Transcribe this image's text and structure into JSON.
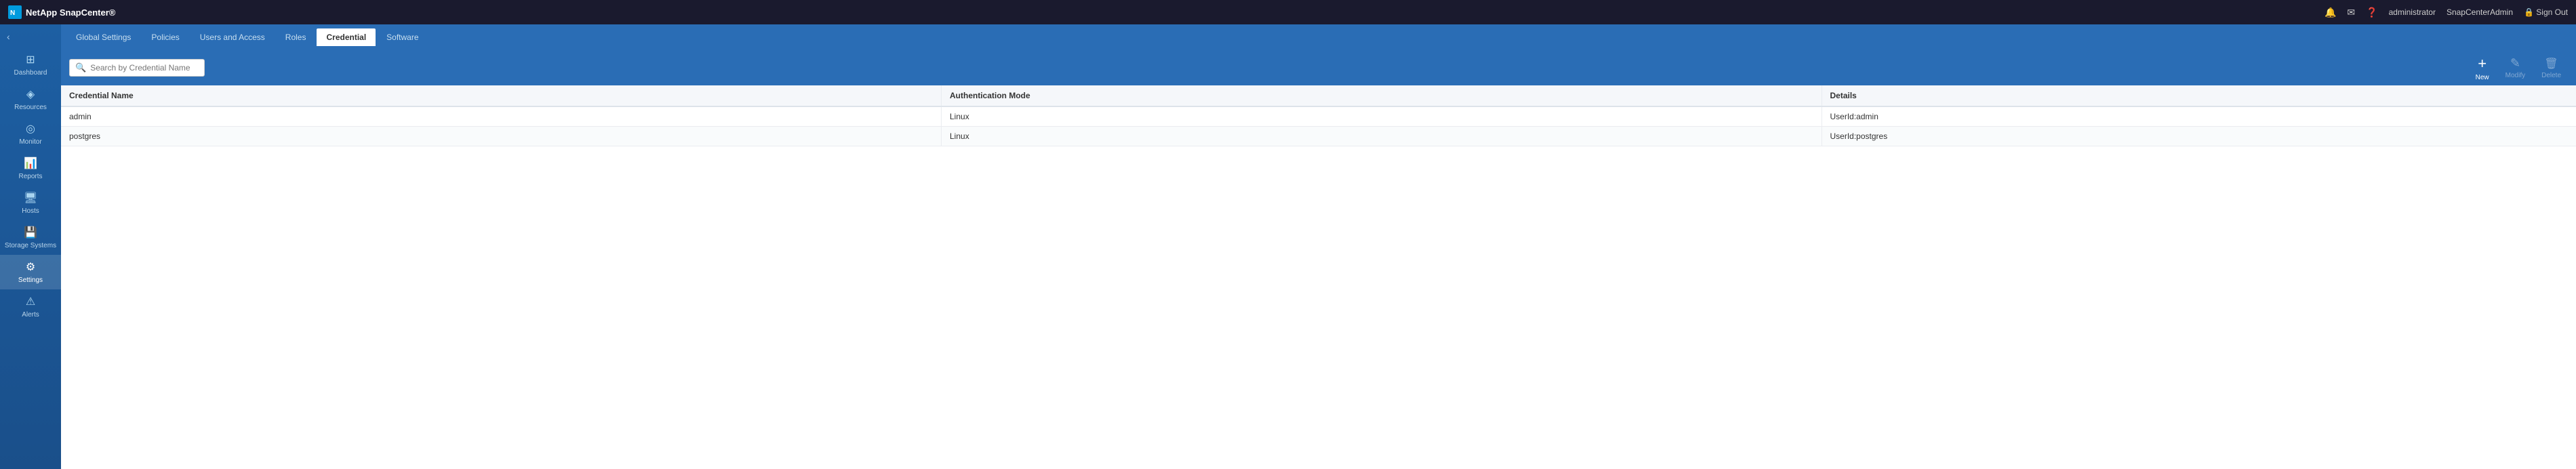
{
  "app": {
    "logo_text": "NetApp SnapCenter®",
    "logo_icon": "⬛"
  },
  "topbar": {
    "notification_icon": "🔔",
    "mail_icon": "✉",
    "help_icon": "❓",
    "user_label": "administrator",
    "tenant_label": "SnapCenterAdmin",
    "signout_label": "Sign Out",
    "signout_icon": "🔒"
  },
  "sidebar": {
    "collapse_icon": "‹",
    "items": [
      {
        "id": "dashboard",
        "label": "Dashboard",
        "icon": "⊞",
        "active": false
      },
      {
        "id": "resources",
        "label": "Resources",
        "icon": "◈",
        "active": false
      },
      {
        "id": "monitor",
        "label": "Monitor",
        "icon": "◎",
        "active": false
      },
      {
        "id": "reports",
        "label": "Reports",
        "icon": "📊",
        "active": false
      },
      {
        "id": "hosts",
        "label": "Hosts",
        "icon": "🖥",
        "active": false
      },
      {
        "id": "storage-systems",
        "label": "Storage Systems",
        "icon": "💾",
        "active": false
      },
      {
        "id": "settings",
        "label": "Settings",
        "icon": "⚙",
        "active": true
      },
      {
        "id": "alerts",
        "label": "Alerts",
        "icon": "⚠",
        "active": false
      }
    ]
  },
  "subnav": {
    "tabs": [
      {
        "id": "global-settings",
        "label": "Global Settings",
        "active": false
      },
      {
        "id": "policies",
        "label": "Policies",
        "active": false
      },
      {
        "id": "users-access",
        "label": "Users and Access",
        "active": false
      },
      {
        "id": "roles",
        "label": "Roles",
        "active": false
      },
      {
        "id": "credential",
        "label": "Credential",
        "active": true
      },
      {
        "id": "software",
        "label": "Software",
        "active": false
      }
    ]
  },
  "toolbar": {
    "search_placeholder": "Search by Credential Name",
    "search_icon": "🔍",
    "actions": [
      {
        "id": "new",
        "label": "New",
        "icon": "+",
        "disabled": false
      },
      {
        "id": "modify",
        "label": "Modify",
        "icon": "✎",
        "disabled": true
      },
      {
        "id": "delete",
        "label": "Delete",
        "icon": "🗑",
        "disabled": true
      }
    ]
  },
  "table": {
    "columns": [
      {
        "id": "cred-name",
        "label": "Credential Name"
      },
      {
        "id": "auth-mode",
        "label": "Authentication Mode"
      },
      {
        "id": "details",
        "label": "Details"
      }
    ],
    "rows": [
      {
        "cred_name": "admin",
        "auth_mode": "Linux",
        "details": "UserId:admin"
      },
      {
        "cred_name": "postgres",
        "auth_mode": "Linux",
        "details": "UserId:postgres"
      }
    ]
  }
}
